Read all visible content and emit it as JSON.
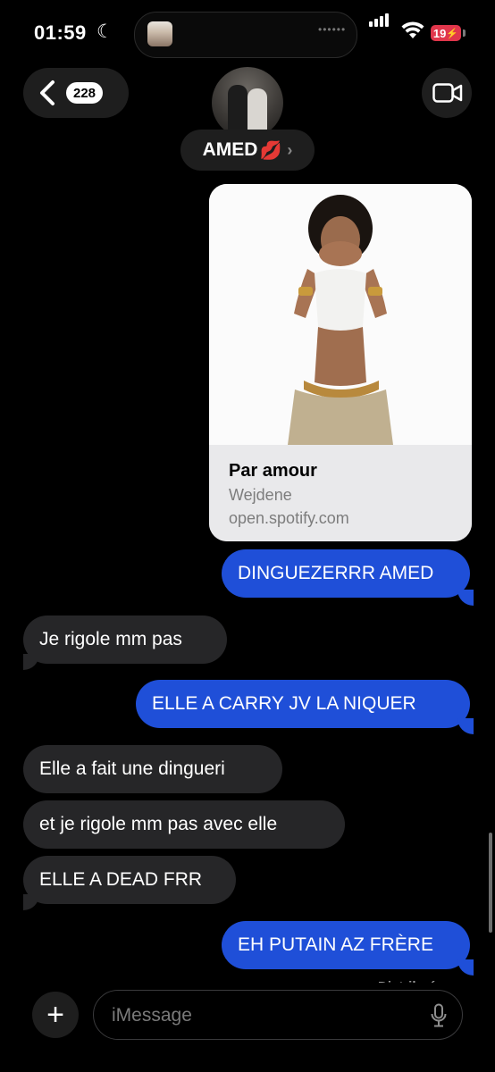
{
  "status_bar": {
    "time": "01:59",
    "moon_icon": "moon-icon",
    "battery": "19",
    "battery_color": "#e0364b"
  },
  "header": {
    "unread_count": "228",
    "contact_name": "AMED",
    "contact_emoji": "💋",
    "back_icon": "chevron-left-icon",
    "video_icon": "video-camera-icon"
  },
  "link_preview": {
    "title": "Par amour",
    "artist": "Wejdene",
    "domain": "open.spotify.com"
  },
  "messages": [
    {
      "direction": "sent",
      "text": "DINGUEZERRR AMED"
    },
    {
      "direction": "received",
      "text": "Je rigole mm pas"
    },
    {
      "direction": "sent",
      "text": "ELLE A CARRY JV LA NIQUER"
    },
    {
      "direction": "received",
      "text": "Elle a fait une dingueri"
    },
    {
      "direction": "received",
      "text": "et je rigole mm pas avec elle"
    },
    {
      "direction": "received",
      "text": "ELLE A DEAD FRR"
    },
    {
      "direction": "sent",
      "text": "EH PUTAIN AZ FRÈRE"
    }
  ],
  "delivery_status": "Distribué",
  "composer": {
    "placeholder": "iMessage",
    "plus_label": "+"
  },
  "colors": {
    "sent_bubble": "#1f4fd8",
    "received_bubble": "#262628",
    "background": "#000000"
  }
}
